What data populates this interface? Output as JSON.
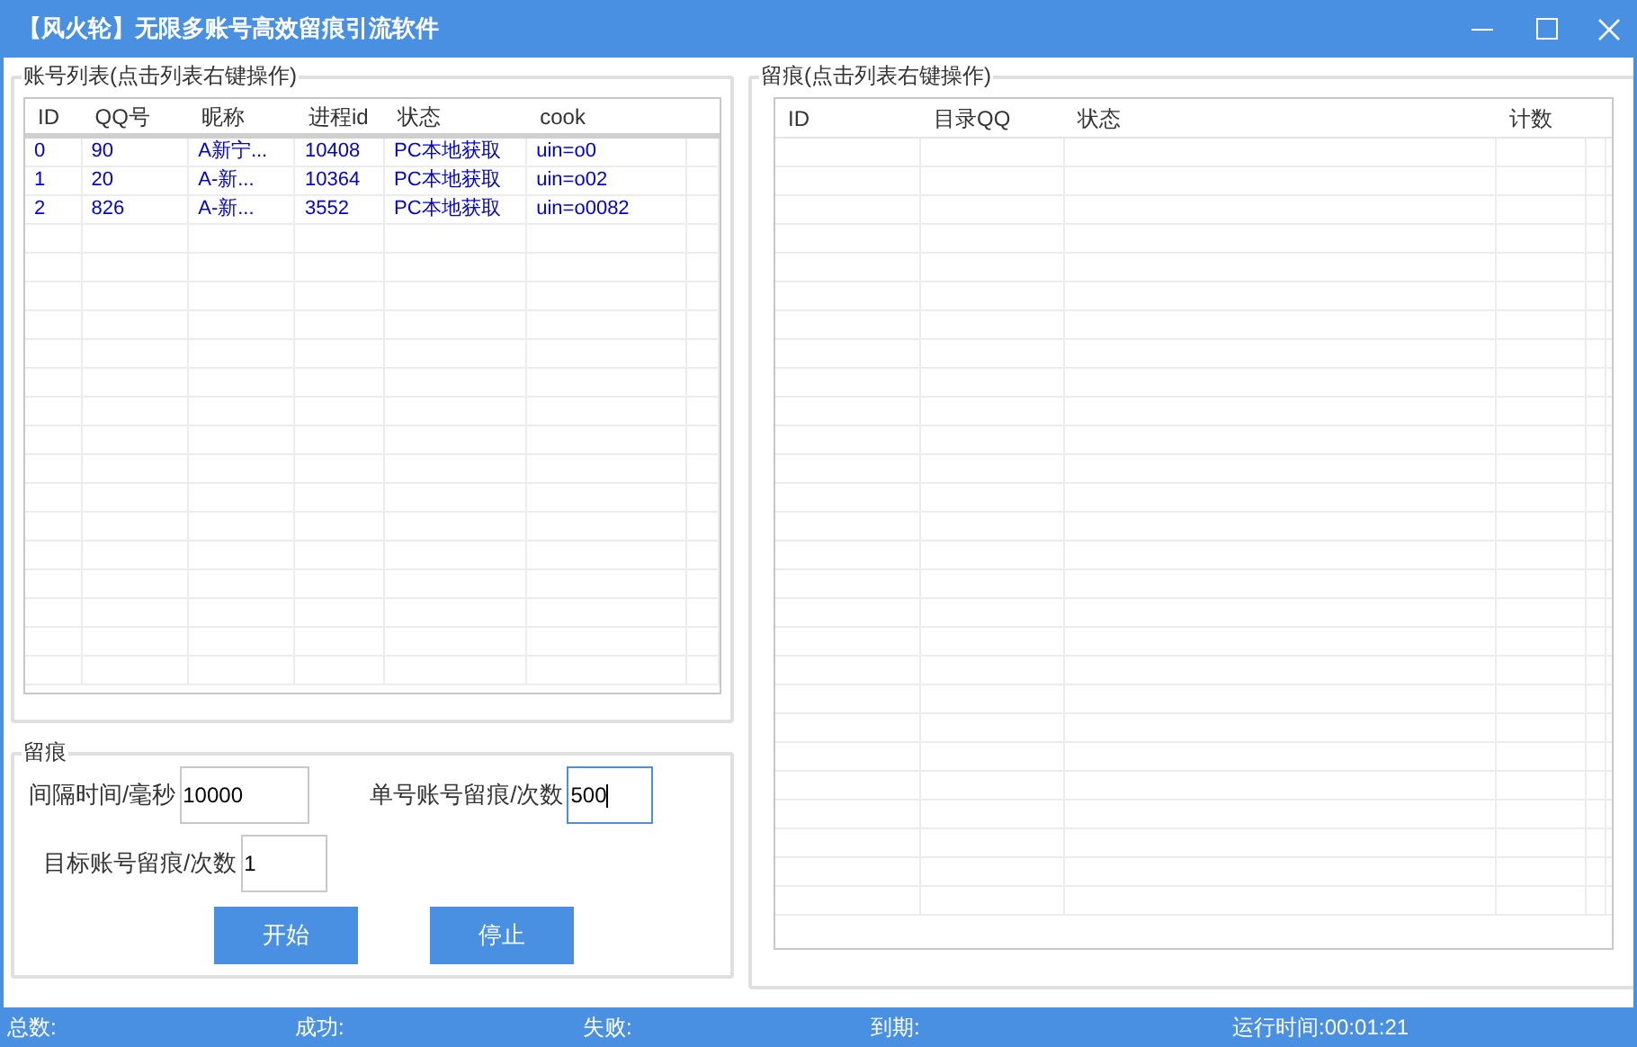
{
  "window": {
    "title": "【风火轮】无限多账号高效留痕引流软件"
  },
  "accounts": {
    "title": "账号列表(点击列表右键操作)",
    "columns": [
      "ID",
      "QQ号",
      "昵称",
      "进程id",
      "状态",
      "cook"
    ],
    "rows": [
      [
        "0",
        "90",
        "A新宁...",
        "10408",
        "PC本地获取",
        "uin=o0"
      ],
      [
        "1",
        "20",
        "A-新...",
        "10364",
        "PC本地获取",
        "uin=o02"
      ],
      [
        "2",
        "826",
        "A-新...",
        "3552",
        "PC本地获取",
        "uin=o0082"
      ]
    ]
  },
  "traces": {
    "title": "留痕(点击列表右键操作)",
    "columns": [
      "ID",
      "目录QQ",
      "状态",
      "计数"
    ]
  },
  "settings": {
    "title": "留痕",
    "fields": [
      {
        "label": "间隔时间/毫秒",
        "value": "10000",
        "focused": false
      },
      {
        "label": "单号账号留痕/次数",
        "value": "500",
        "focused": true
      },
      {
        "label": "目标账号留痕/次数",
        "value": "1",
        "focused": false
      }
    ],
    "buttons": [
      "开始",
      "停止"
    ]
  },
  "status_bar": [
    "总数:",
    "成功:",
    "失败:",
    "到期:",
    "运行时间:00:01:21"
  ]
}
